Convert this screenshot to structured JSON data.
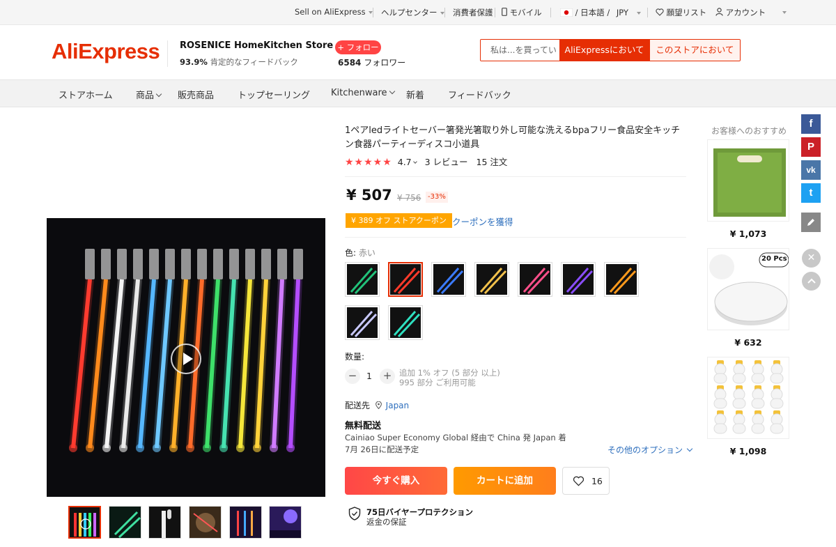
{
  "topbar": {
    "sell": "Sell on AliExpress",
    "help": "ヘルプセンター",
    "buyer": "消費者保護",
    "mobile": "モバイル",
    "lang": "/ 日本語 /",
    "currency": "JPY",
    "wishlist": "願望リスト",
    "account": "アカウント"
  },
  "header": {
    "logo": "AliExpress",
    "store_name": "ROSENICE HomeKitchen Store",
    "feedback_pct": "93.9%",
    "feedback_label": "肯定的なフィードバック",
    "follow_label": "+ フォロー",
    "followers_count": "6584",
    "followers_label": "フォロワー",
    "search_placeholder": "私は...を買ってい",
    "search_global": "AliExpressにおいて",
    "search_store": "このストアにおいて"
  },
  "nav": {
    "items": [
      "ストアホーム",
      "商品",
      "販売商品",
      "トップセーリング",
      "Kitchenware",
      "新着",
      "フィードバック"
    ]
  },
  "product": {
    "title": "1ペアledライトセーバー箸発光箸取り外し可能な洗えるbpaフリー食品安全キッチン食器パーティーディスコ小道具",
    "stars": "★★★★★",
    "rating": "4.7",
    "reviews": "3 レビュー",
    "orders": "15 注文",
    "price": "¥ 507",
    "old_price": "¥ 756",
    "discount": "-33%",
    "coupon": "¥ 389 オフ ストアクーポン",
    "coupon_link": "クーポンを獲得",
    "color_label": "色:",
    "color_value": "赤い",
    "qty_label": "数量:",
    "qty_value": "1",
    "qty_note1": "追加 1% オフ (5 部分 以上)",
    "qty_note2": "995 部分 ご利用可能",
    "ship_to_label": "配送先",
    "ship_to_value": "Japan",
    "free_shipping": "無料配送",
    "ship_line1": "Cainiao Super Economy Global 経由で China 発 Japan 着",
    "ship_line2": "7月 26日に配送予定",
    "other_options": "その他のオプション",
    "buy_now": "今すぐ購入",
    "add_cart": "カートに追加",
    "wish_count": "16",
    "protection_title": "75日バイヤープロテクション",
    "protection_sub": "返金の保証"
  },
  "sku_colors": [
    "#22c27a",
    "#ff3a2a",
    "#3b7bff",
    "#f2c14b",
    "#ff4f8a",
    "#8a4dff",
    "#ff9a1c",
    "#c9c9ff",
    "#2ee0c0"
  ],
  "recommend": {
    "title": "お客様へのおすすめ",
    "items": [
      {
        "price": "¥ 1,073"
      },
      {
        "price": "¥ 632",
        "badge": "20 Pcs"
      },
      {
        "price": "¥ 1,098"
      }
    ]
  },
  "social": [
    "f",
    "P",
    "vk",
    "t"
  ]
}
